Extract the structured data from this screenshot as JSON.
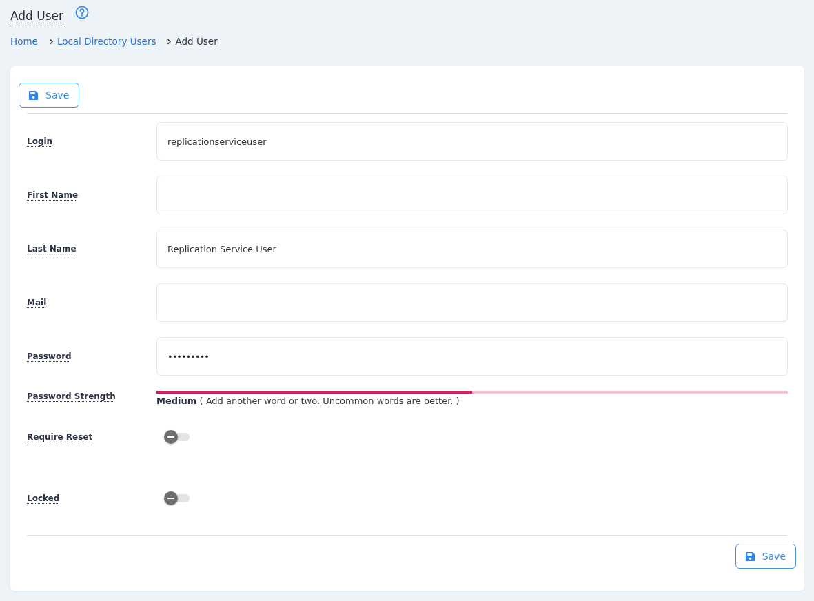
{
  "page": {
    "title": "Add User"
  },
  "breadcrumb": [
    {
      "label": "Home",
      "current": false
    },
    {
      "label": "Local Directory Users",
      "current": false
    },
    {
      "label": "Add User",
      "current": true
    }
  ],
  "top_actions": [
    {
      "label": "Save"
    }
  ],
  "fields": [
    {
      "kind": "text",
      "label": "Login",
      "value": "replicationserviceuser"
    },
    {
      "kind": "text",
      "label": "First Name"
    },
    {
      "kind": "text",
      "label": "Last Name",
      "value": "Replication Service User"
    },
    {
      "kind": "text",
      "label": "Mail"
    },
    {
      "kind": "password",
      "label": "Password",
      "value": "•••••••••"
    },
    {
      "kind": "strength",
      "label": "Password Strength",
      "level": 0.5,
      "text": "**Medium** ( Add another word or two. Uncommon words are better. )"
    },
    {
      "kind": "toggle",
      "label": "Require Reset",
      "on": false
    },
    {
      "kind": "toggle",
      "label": "Locked",
      "on": false
    }
  ],
  "bottom_actions": [
    {
      "label": "Save"
    }
  ]
}
